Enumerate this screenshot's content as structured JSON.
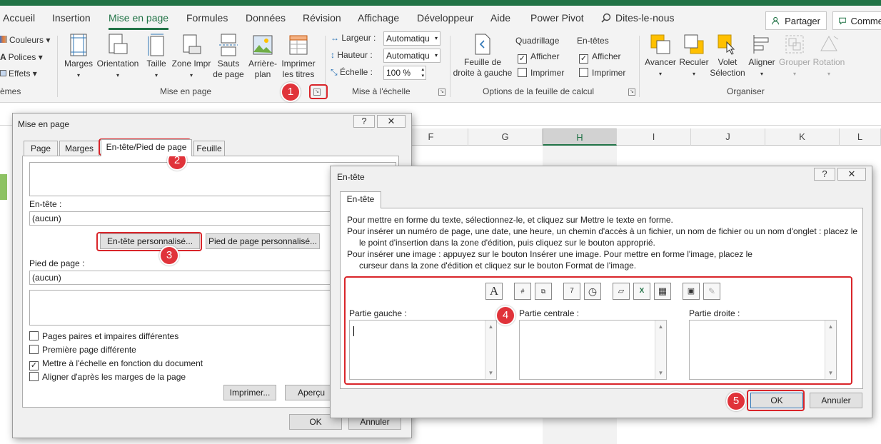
{
  "ribbon": {
    "tabs": [
      "Accueil",
      "Insertion",
      "Mise en page",
      "Formules",
      "Données",
      "Révision",
      "Affichage",
      "Développeur",
      "Aide",
      "Power Pivot"
    ],
    "tell_me": "Dites-le-nous",
    "share": "Partager",
    "comments": "Comme",
    "themes_items": [
      "Couleurs",
      "Polices",
      "Effets"
    ],
    "themes_group": "èmes",
    "page_setup_buttons": [
      "Marges",
      "Orientation",
      "Taille",
      "Zone Impr",
      "Sauts de page",
      "Arrière-plan",
      "Imprimer les titres"
    ],
    "page_setup_group": "Mise en page",
    "scale": {
      "largeur_label": "Largeur :",
      "largeur_value": "Automatiqu",
      "hauteur_label": "Hauteur :",
      "hauteur_value": "Automatiqu",
      "echelle_label": "Échelle :",
      "echelle_value": "100 %",
      "group": "Mise à l'échelle"
    },
    "sheet_options": {
      "button": "Feuille de droite à gauche",
      "grid_title": "Quadrillage",
      "headers_title": "En-têtes",
      "show": "Afficher",
      "print": "Imprimer",
      "group": "Options de la feuille de calcul"
    },
    "arrange": {
      "buttons": [
        "Avancer",
        "Reculer",
        "Volet Sélection",
        "Aligner",
        "Grouper",
        "Rotation"
      ],
      "group": "Organiser"
    }
  },
  "sheet": {
    "columns": [
      "F",
      "G",
      "H",
      "I",
      "J",
      "K",
      "L"
    ],
    "selected_column": "H"
  },
  "page_setup_dialog": {
    "title": "Mise en page",
    "help": "?",
    "close": "✕",
    "tabs": [
      "Page",
      "Marges",
      "En-tête/Pied de page",
      "Feuille"
    ],
    "header_label": "En-tête :",
    "header_value": "(aucun)",
    "custom_header_btn": "En-tête personnalisé...",
    "custom_footer_btn": "Pied de page personnalisé...",
    "footer_label": "Pied de page :",
    "footer_value": "(aucun)",
    "options": [
      {
        "label": "Pages paires et impaires différentes",
        "checked": false
      },
      {
        "label": "Première page différente",
        "checked": false
      },
      {
        "label": "Mettre à l'échelle en fonction du document",
        "checked": true
      },
      {
        "label": "Aligner d'après les marges de la page",
        "checked": false
      }
    ],
    "print_btn": "Imprimer...",
    "preview_btn": "Aperçu",
    "ok": "OK",
    "cancel": "Annuler"
  },
  "header_dialog": {
    "title": "En-tête",
    "help": "?",
    "close": "✕",
    "tab": "En-tête",
    "instructions": [
      "Pour mettre en forme du texte, sélectionnez-le, et cliquez sur Mettre le texte en forme.",
      "Pour insérer un numéro de page, une date, une heure, un chemin d'accès à un fichier, un nom de fichier ou un nom d'onglet : placez le",
      "le point d'insertion dans la zone d'édition, puis cliquez sur le bouton approprié.",
      "Pour insérer une image : appuyez sur le bouton Insérer une image. Pour mettre en forme l'image, placez le",
      "curseur dans la zone d'édition et cliquez sur le bouton Format de l'image."
    ],
    "left_label": "Partie gauche :",
    "center_label": "Partie centrale :",
    "right_label": "Partie droite :",
    "ok": "OK",
    "cancel": "Annuler"
  },
  "markers": [
    "1",
    "2",
    "3",
    "4",
    "5"
  ],
  "colors": {
    "excel_green": "#217346",
    "marker_red": "#e0333a",
    "annotation_red": "#d9252a"
  }
}
